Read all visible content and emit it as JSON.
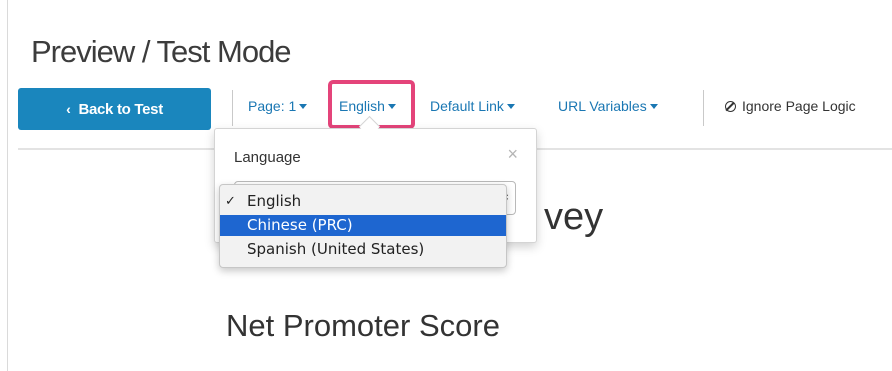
{
  "header": {
    "title": "Preview / Test Mode"
  },
  "toolbar": {
    "back_label": "Back to Test",
    "page_label": "Page: 1",
    "language_label": "English",
    "default_link_label": "Default Link",
    "url_variables_label": "URL Variables",
    "ignore_logic_label": "Ignore Page Logic"
  },
  "popover": {
    "title": "Language",
    "close_glyph": "×",
    "selected_value": "English",
    "options": [
      {
        "label": "English",
        "checked": true,
        "highlighted": false
      },
      {
        "label": "Chinese (PRC)",
        "checked": false,
        "highlighted": true
      },
      {
        "label": "Spanish (United States)",
        "checked": false,
        "highlighted": false
      }
    ]
  },
  "survey": {
    "heading_fragment": "vey",
    "section_heading": "Net Promoter Score"
  },
  "colors": {
    "accent": "#1a86bd",
    "link": "#1a77b3",
    "highlight_border": "#e4447a",
    "option_selected": "#1e66d0"
  },
  "icons": {
    "back": "chevron-left-icon",
    "ignore": "ban-icon",
    "close": "close-icon",
    "check": "checkmark-icon"
  }
}
